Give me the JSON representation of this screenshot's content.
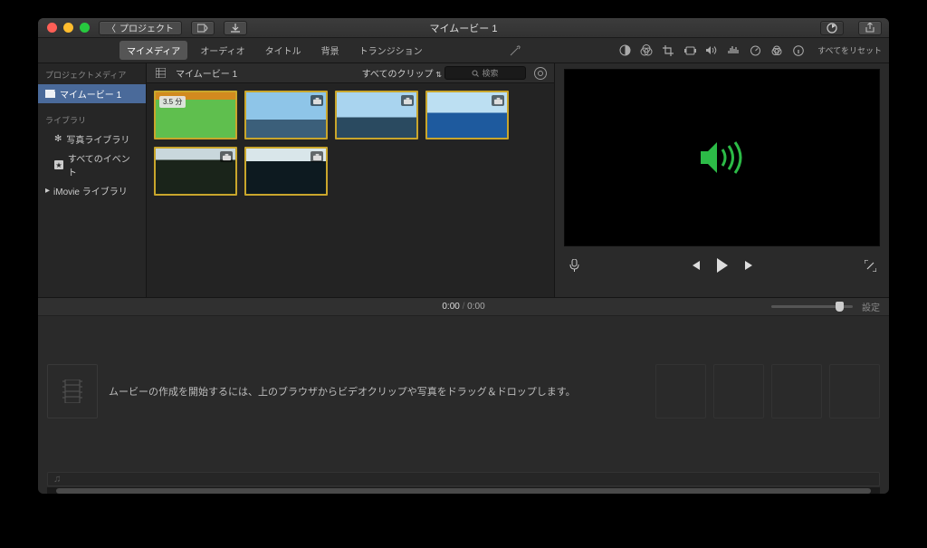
{
  "titlebar": {
    "back_label": "プロジェクト",
    "title": "マイムービー 1"
  },
  "tabs": {
    "items": [
      "マイメディア",
      "オーディオ",
      "タイトル",
      "背景",
      "トランジション"
    ],
    "active_index": 0,
    "reset_label": "すべてをリセット"
  },
  "sidebar": {
    "header_project": "プロジェクトメディア",
    "active_project": "マイムービー 1",
    "header_library": "ライブラリ",
    "items": [
      {
        "label": "写真ライブラリ",
        "icon": "flower-icon"
      },
      {
        "label": "すべてのイベント",
        "icon": "star-icon"
      }
    ],
    "imovie_lib": "iMovie ライブラリ"
  },
  "browser": {
    "breadcrumb": "マイムービー 1",
    "filter_label": "すべてのクリップ",
    "search_placeholder": "検索",
    "clips": [
      {
        "duration_badge": "3.5 分",
        "kind": "project"
      },
      {
        "kind": "photo"
      },
      {
        "kind": "photo"
      },
      {
        "kind": "photo"
      },
      {
        "kind": "photo"
      },
      {
        "kind": "photo"
      }
    ]
  },
  "viewer": {
    "icon": "speaker-icon",
    "icon_color": "#2cbb47"
  },
  "timeline": {
    "current": "0:00",
    "total": "0:00",
    "settings_label": "設定",
    "empty_message": "ムービーの作成を開始するには、上のブラウザからビデオクリップや写真をドラッグ＆ドロップします。"
  }
}
